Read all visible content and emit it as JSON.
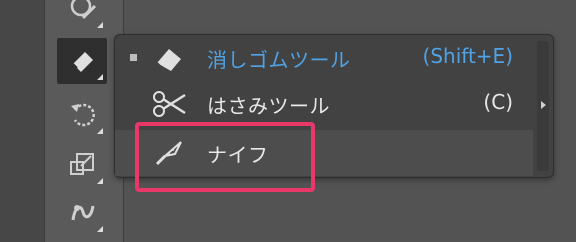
{
  "toolbar": {
    "tools": [
      {
        "icon": "shaper-icon",
        "selected": false
      },
      {
        "icon": "eraser-icon",
        "selected": true
      },
      {
        "icon": "rotate-icon",
        "selected": false
      },
      {
        "icon": "scale-icon",
        "selected": false
      },
      {
        "icon": "warp-icon",
        "selected": false
      }
    ]
  },
  "flyout": {
    "items": [
      {
        "label": "消しゴムツール",
        "shortcut": "(Shift+E)",
        "icon": "eraser-icon",
        "active": true
      },
      {
        "label": "はさみツール",
        "shortcut": "(C)",
        "icon": "scissors-icon",
        "active": false
      },
      {
        "label": "ナイフ",
        "shortcut": "",
        "icon": "knife-icon",
        "active": false
      }
    ]
  },
  "colors": {
    "active_text": "#4fa3e6",
    "highlight": "#e8386a"
  }
}
